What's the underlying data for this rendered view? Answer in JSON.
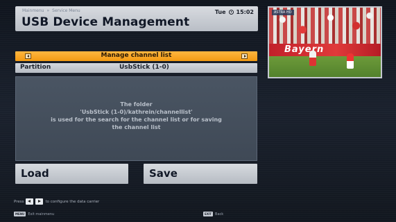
{
  "header": {
    "breadcrumb": [
      "Mainmenu",
      "»",
      "Service Menu"
    ],
    "title": "USB Device Management",
    "day": "Tue",
    "time": "15:02",
    "clock_icon": "clock-icon"
  },
  "preview": {
    "channel": "ASTRA HD",
    "banner_text": "Bayern"
  },
  "manage_bar": {
    "label": "Manage channel list",
    "left_icon": "arrow-left-icon",
    "right_icon": "arrow-right-icon",
    "color": "#f39a12"
  },
  "partition": {
    "label": "Partition",
    "value": "UsbStick (1-0)"
  },
  "info": {
    "lines": [
      "The folder",
      "'UsbStick (1-0)/kathrein/channellist'",
      "is used for the search for the channel list or for saving",
      "the channel list"
    ]
  },
  "buttons": {
    "load": "Load",
    "save": "Save"
  },
  "hint": {
    "prefix": "Press",
    "suffix": "to configure the data carrier"
  },
  "footer": {
    "exit_key": "MENU",
    "exit_label": "Exit mainmenu",
    "back_key": "EXIT",
    "back_label": "Back"
  }
}
